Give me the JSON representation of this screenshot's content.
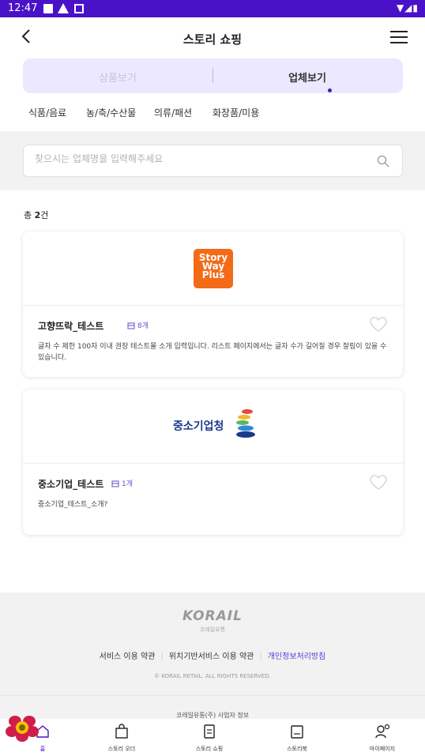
{
  "status_bar": {
    "time": "12:47"
  },
  "app_bar": {
    "title": "스토리 쇼핑"
  },
  "segment": {
    "option_products": "상품보기",
    "option_companies": "업체보기",
    "selected": "업체보기"
  },
  "categories": [
    "식품/음료",
    "농/축/수산물",
    "의류/패션",
    "화장품/미용"
  ],
  "search": {
    "placeholder": "찾으시는 업체명을 입력해주세요"
  },
  "result_count": {
    "prefix": "총 ",
    "number": "2",
    "suffix": "건"
  },
  "companies": [
    {
      "name": "고향뜨락_테스트",
      "badge": "8개",
      "logo_text": "Story Way Plus",
      "description": "글자 수 제한 100자 이내 권장 테스트몰 소개 입력입니다. 리스트 페이지에서는 글자 수가 길어질 경우 잘림이 있을 수 있습니다."
    },
    {
      "name": "중소기업_테스트",
      "badge": "1개",
      "logo_text": "중소기업청",
      "description": "중소기업_테스트_소개?"
    }
  ],
  "footer": {
    "brand": "KORAIL",
    "brand_sub": "코레일유통",
    "link_terms": "서비스 이용 약관",
    "link_location": "위치기반서비스 이용 약관",
    "link_privacy": "개인정보처리방침",
    "copyright": "© KORAIL RETAIL. ALL RIGHTS RESERVED.",
    "company_info": "코레일유통(주) 사업자 정보"
  },
  "bottom_nav": {
    "home": "홈",
    "order": "스토리 오더",
    "shopping": "스토리 쇼핑",
    "book": "스토리북",
    "mypage": "마이페이지"
  },
  "colors": {
    "accent": "#4a12c8",
    "segment_bg": "#ece8ff",
    "orange_logo": "#f36a17"
  }
}
